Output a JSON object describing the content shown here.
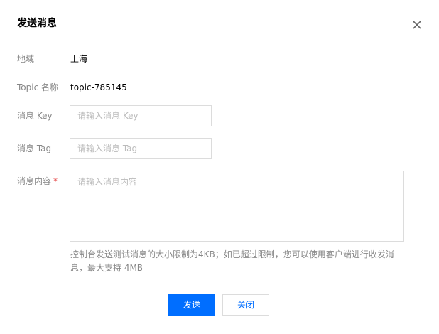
{
  "dialog": {
    "title": "发送消息",
    "close_icon": "close-icon"
  },
  "form": {
    "region": {
      "label": "地域",
      "value": "上海"
    },
    "topic": {
      "label": "Topic 名称",
      "value": "topic-785145"
    },
    "key": {
      "label": "消息 Key",
      "placeholder": "请输入消息 Key",
      "value": ""
    },
    "tag": {
      "label": "消息 Tag",
      "placeholder": "请输入消息 Tag",
      "value": ""
    },
    "content": {
      "label": "消息内容",
      "required_mark": "*",
      "placeholder": "请输入消息内容",
      "value": ""
    },
    "hint": "控制台发送测试消息的大小限制为4KB；如已超过限制，您可以使用客户端进行收发消息，最大支持 4MB"
  },
  "actions": {
    "send_label": "发送",
    "close_label": "关闭"
  },
  "colors": {
    "primary": "#006eff",
    "required": "#e54545",
    "label": "#888888",
    "border": "#dcdcdc"
  }
}
